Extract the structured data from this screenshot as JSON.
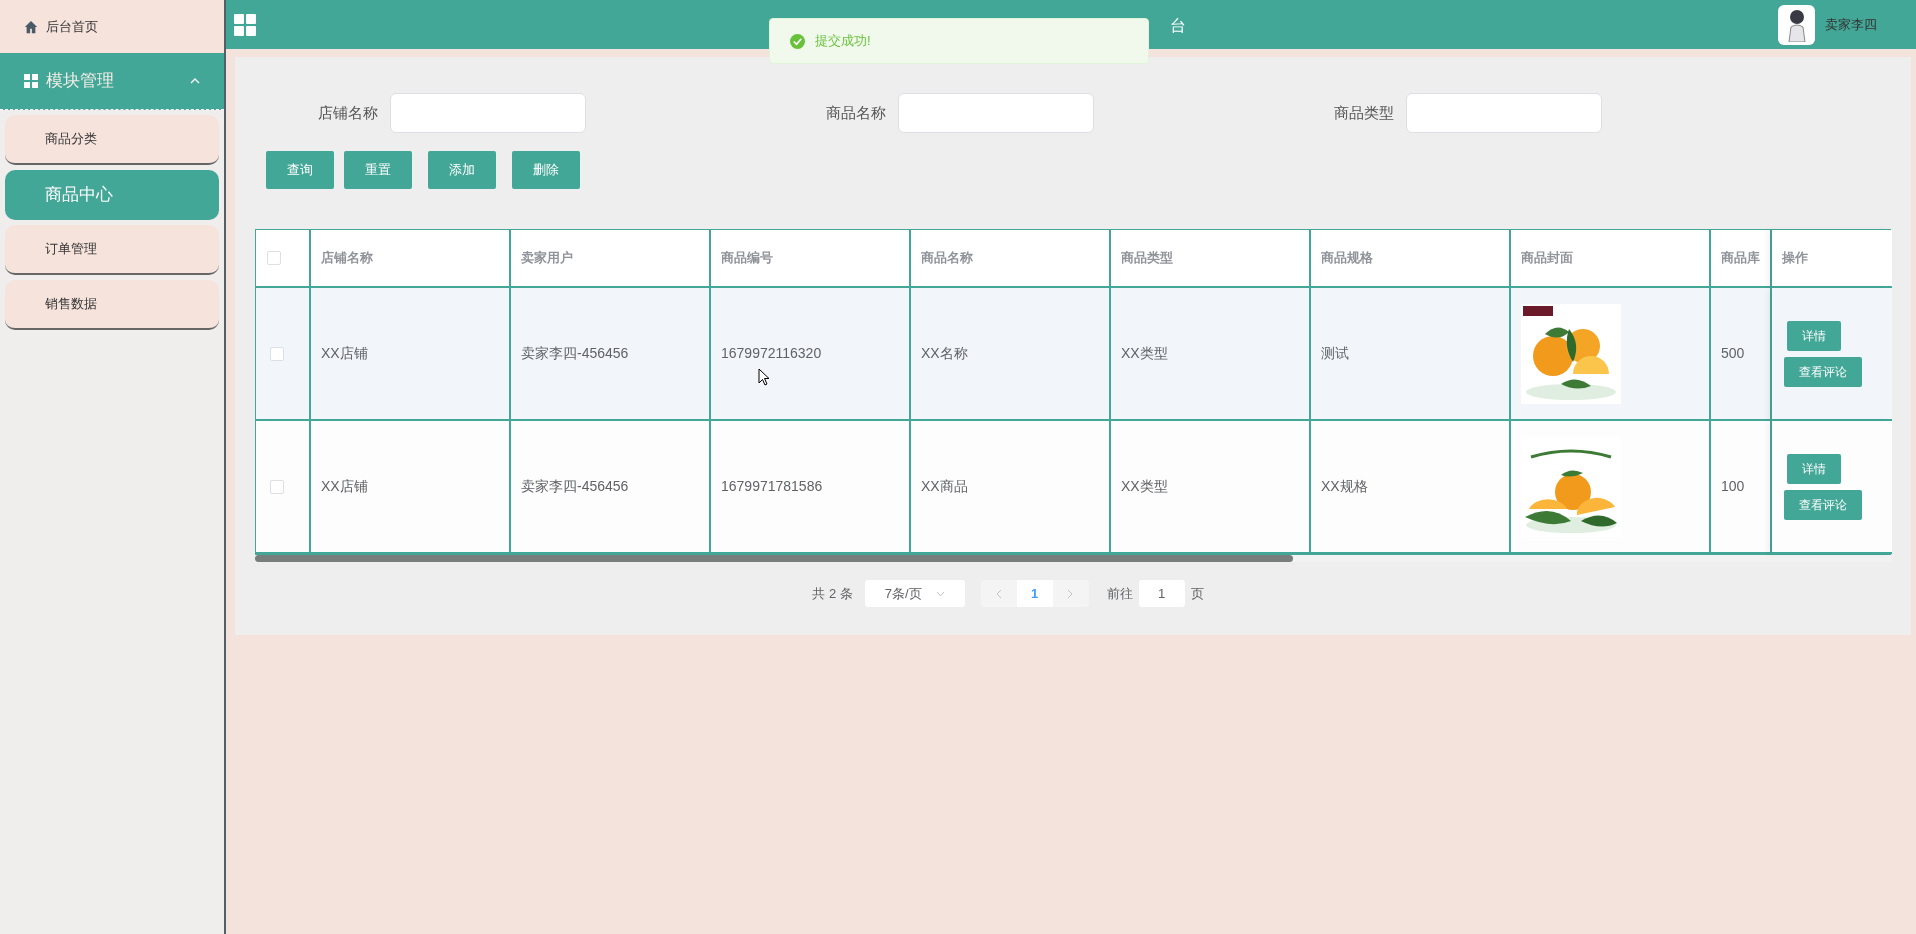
{
  "sidebar": {
    "home": "后台首页",
    "group": {
      "label": "模块管理",
      "expanded": true
    },
    "items": [
      {
        "label": "商品分类",
        "selected": false
      },
      {
        "label": "商品中心",
        "selected": true
      },
      {
        "label": "订单管理",
        "selected": false
      },
      {
        "label": "销售数据",
        "selected": false
      }
    ]
  },
  "header": {
    "title": "台",
    "user": "卖家李四"
  },
  "toast": {
    "message": "提交成功!"
  },
  "search": {
    "fields": [
      {
        "label": "店铺名称"
      },
      {
        "label": "商品名称"
      },
      {
        "label": "商品类型"
      }
    ],
    "buttons": [
      "查询",
      "重置",
      "添加",
      "删除"
    ]
  },
  "table": {
    "columns": [
      "店铺名称",
      "卖家用户",
      "商品编号",
      "商品名称",
      "商品类型",
      "商品规格",
      "商品封面",
      "商品库"
    ],
    "action_column": "操作",
    "all_checked": false,
    "rows": [
      {
        "checked": false,
        "cells": [
          "XX店铺",
          "卖家李四-456456",
          "1679972116320",
          "XX名称",
          "XX类型",
          "测试"
        ],
        "cover": {
          "kind": "picture"
        },
        "stock": "500",
        "actions": [
          "详情",
          "查看评论"
        ]
      },
      {
        "checked": false,
        "cells": [
          "XX店铺",
          "卖家李四-456456",
          "1679971781586",
          "XX商品",
          "XX类型",
          "XX规格"
        ],
        "cover": {
          "kind": "picture"
        },
        "stock": "100",
        "actions": [
          "详情",
          "查看评论"
        ]
      }
    ]
  },
  "pagination": {
    "total": "共 2 条",
    "page_size": "7条/页",
    "pages": [
      {
        "label": "1",
        "selected": true
      }
    ],
    "goto_label": "前往",
    "goto_value": "1",
    "goto_suffix": "页"
  }
}
